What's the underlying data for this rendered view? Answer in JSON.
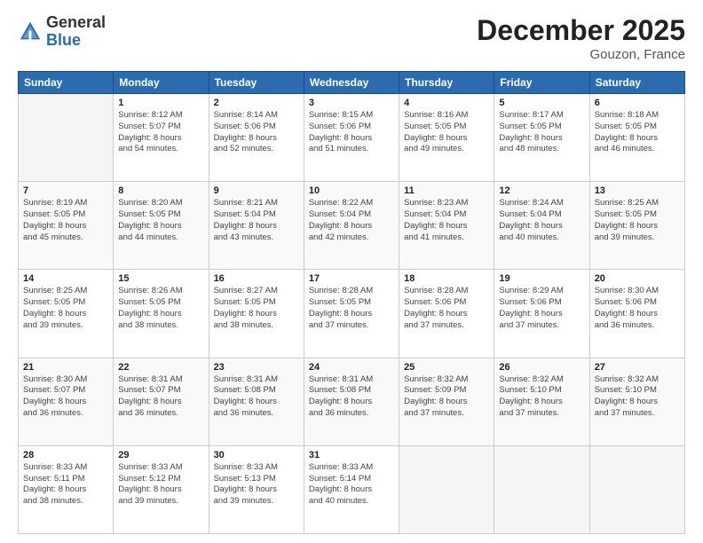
{
  "logo": {
    "general": "General",
    "blue": "Blue"
  },
  "title": "December 2025",
  "location": "Gouzon, France",
  "days_of_week": [
    "Sunday",
    "Monday",
    "Tuesday",
    "Wednesday",
    "Thursday",
    "Friday",
    "Saturday"
  ],
  "weeks": [
    [
      {
        "day": "",
        "info": ""
      },
      {
        "day": "1",
        "info": "Sunrise: 8:12 AM\nSunset: 5:07 PM\nDaylight: 8 hours\nand 54 minutes."
      },
      {
        "day": "2",
        "info": "Sunrise: 8:14 AM\nSunset: 5:06 PM\nDaylight: 8 hours\nand 52 minutes."
      },
      {
        "day": "3",
        "info": "Sunrise: 8:15 AM\nSunset: 5:06 PM\nDaylight: 8 hours\nand 51 minutes."
      },
      {
        "day": "4",
        "info": "Sunrise: 8:16 AM\nSunset: 5:05 PM\nDaylight: 8 hours\nand 49 minutes."
      },
      {
        "day": "5",
        "info": "Sunrise: 8:17 AM\nSunset: 5:05 PM\nDaylight: 8 hours\nand 48 minutes."
      },
      {
        "day": "6",
        "info": "Sunrise: 8:18 AM\nSunset: 5:05 PM\nDaylight: 8 hours\nand 46 minutes."
      }
    ],
    [
      {
        "day": "7",
        "info": "Sunrise: 8:19 AM\nSunset: 5:05 PM\nDaylight: 8 hours\nand 45 minutes."
      },
      {
        "day": "8",
        "info": "Sunrise: 8:20 AM\nSunset: 5:05 PM\nDaylight: 8 hours\nand 44 minutes."
      },
      {
        "day": "9",
        "info": "Sunrise: 8:21 AM\nSunset: 5:04 PM\nDaylight: 8 hours\nand 43 minutes."
      },
      {
        "day": "10",
        "info": "Sunrise: 8:22 AM\nSunset: 5:04 PM\nDaylight: 8 hours\nand 42 minutes."
      },
      {
        "day": "11",
        "info": "Sunrise: 8:23 AM\nSunset: 5:04 PM\nDaylight: 8 hours\nand 41 minutes."
      },
      {
        "day": "12",
        "info": "Sunrise: 8:24 AM\nSunset: 5:04 PM\nDaylight: 8 hours\nand 40 minutes."
      },
      {
        "day": "13",
        "info": "Sunrise: 8:25 AM\nSunset: 5:05 PM\nDaylight: 8 hours\nand 39 minutes."
      }
    ],
    [
      {
        "day": "14",
        "info": "Sunrise: 8:25 AM\nSunset: 5:05 PM\nDaylight: 8 hours\nand 39 minutes."
      },
      {
        "day": "15",
        "info": "Sunrise: 8:26 AM\nSunset: 5:05 PM\nDaylight: 8 hours\nand 38 minutes."
      },
      {
        "day": "16",
        "info": "Sunrise: 8:27 AM\nSunset: 5:05 PM\nDaylight: 8 hours\nand 38 minutes."
      },
      {
        "day": "17",
        "info": "Sunrise: 8:28 AM\nSunset: 5:05 PM\nDaylight: 8 hours\nand 37 minutes."
      },
      {
        "day": "18",
        "info": "Sunrise: 8:28 AM\nSunset: 5:06 PM\nDaylight: 8 hours\nand 37 minutes."
      },
      {
        "day": "19",
        "info": "Sunrise: 8:29 AM\nSunset: 5:06 PM\nDaylight: 8 hours\nand 37 minutes."
      },
      {
        "day": "20",
        "info": "Sunrise: 8:30 AM\nSunset: 5:06 PM\nDaylight: 8 hours\nand 36 minutes."
      }
    ],
    [
      {
        "day": "21",
        "info": "Sunrise: 8:30 AM\nSunset: 5:07 PM\nDaylight: 8 hours\nand 36 minutes."
      },
      {
        "day": "22",
        "info": "Sunrise: 8:31 AM\nSunset: 5:07 PM\nDaylight: 8 hours\nand 36 minutes."
      },
      {
        "day": "23",
        "info": "Sunrise: 8:31 AM\nSunset: 5:08 PM\nDaylight: 8 hours\nand 36 minutes."
      },
      {
        "day": "24",
        "info": "Sunrise: 8:31 AM\nSunset: 5:08 PM\nDaylight: 8 hours\nand 36 minutes."
      },
      {
        "day": "25",
        "info": "Sunrise: 8:32 AM\nSunset: 5:09 PM\nDaylight: 8 hours\nand 37 minutes."
      },
      {
        "day": "26",
        "info": "Sunrise: 8:32 AM\nSunset: 5:10 PM\nDaylight: 8 hours\nand 37 minutes."
      },
      {
        "day": "27",
        "info": "Sunrise: 8:32 AM\nSunset: 5:10 PM\nDaylight: 8 hours\nand 37 minutes."
      }
    ],
    [
      {
        "day": "28",
        "info": "Sunrise: 8:33 AM\nSunset: 5:11 PM\nDaylight: 8 hours\nand 38 minutes."
      },
      {
        "day": "29",
        "info": "Sunrise: 8:33 AM\nSunset: 5:12 PM\nDaylight: 8 hours\nand 39 minutes."
      },
      {
        "day": "30",
        "info": "Sunrise: 8:33 AM\nSunset: 5:13 PM\nDaylight: 8 hours\nand 39 minutes."
      },
      {
        "day": "31",
        "info": "Sunrise: 8:33 AM\nSunset: 5:14 PM\nDaylight: 8 hours\nand 40 minutes."
      },
      {
        "day": "",
        "info": ""
      },
      {
        "day": "",
        "info": ""
      },
      {
        "day": "",
        "info": ""
      }
    ]
  ]
}
